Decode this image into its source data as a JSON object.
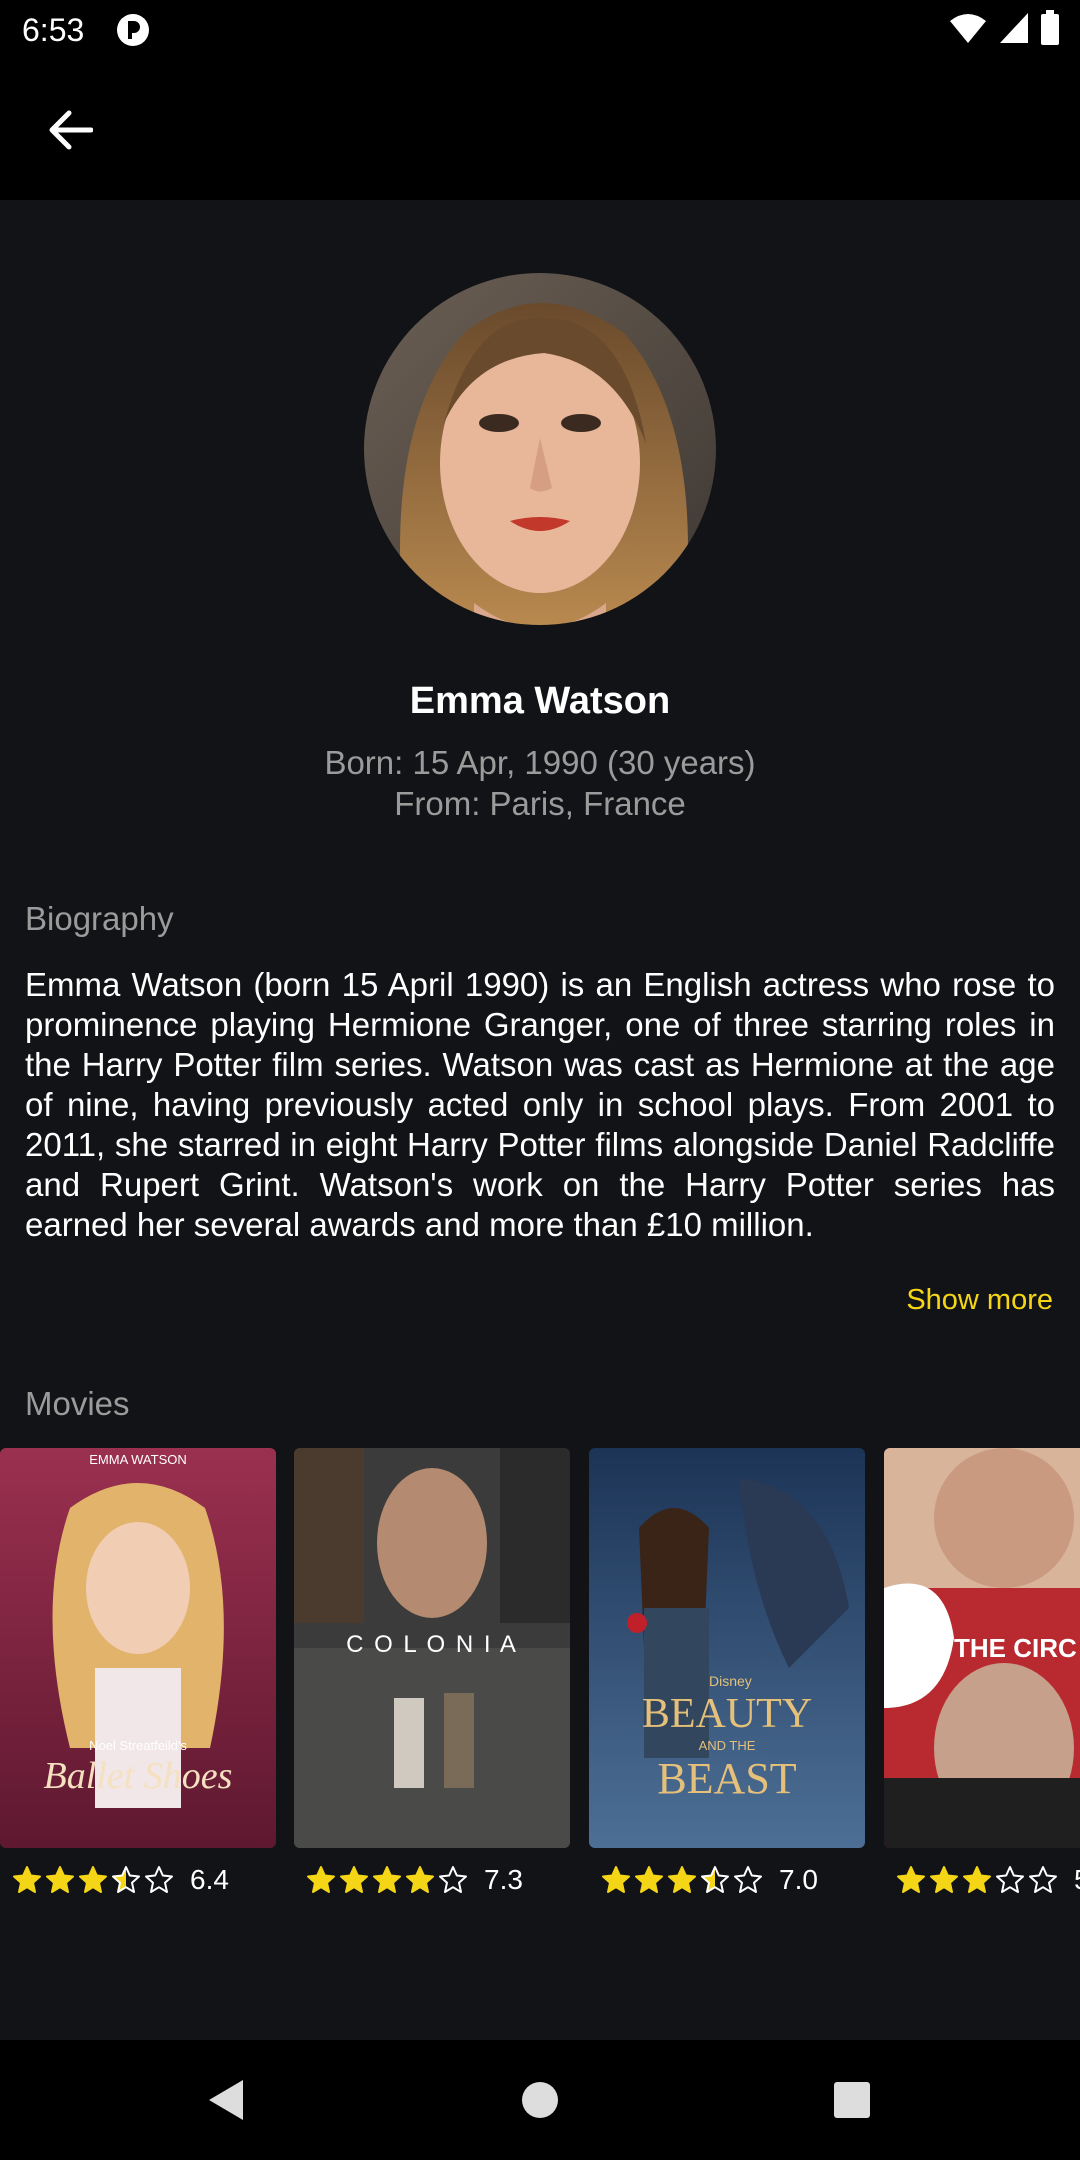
{
  "status": {
    "time": "6:53"
  },
  "person": {
    "name": "Emma Watson",
    "born": "Born: 15 Apr, 1990 (30 years)",
    "from": "From: Paris, France"
  },
  "biography": {
    "label": "Biography",
    "text": "Emma Watson (born 15 April 1990) is an English actress who rose to prominence playing Hermione Granger, one of three starring roles in the Harry Potter film series. Watson was cast as Hermione at the age of nine, having previously acted only in school plays. From 2001 to 2011, she starred in eight Harry Potter films alongside Daniel Radcliffe and Rupert Grint. Watson's work on the Harry Potter series has earned her several awards and more than £10 million.",
    "show_more": "Show more"
  },
  "movies": {
    "label": "Movies",
    "items": [
      {
        "rating": "6.4",
        "stars": 3.5,
        "poster_top": "EMMA WATSON",
        "poster_sub": "Noel Streatfeild's",
        "poster_title": "Ballet Shoes"
      },
      {
        "rating": "7.3",
        "stars": 4,
        "poster_title": "C O L O N I A"
      },
      {
        "rating": "7.0",
        "stars": 3.5,
        "poster_brand": "Disney",
        "poster_title": "BEAUTY",
        "poster_and": "AND THE",
        "poster_title2": "BEAST"
      },
      {
        "rating": "5",
        "stars": 3,
        "poster_title": "THE CIRC"
      }
    ]
  },
  "colors": {
    "accent": "#f5d617",
    "background": "#121316",
    "bar": "#000000"
  }
}
